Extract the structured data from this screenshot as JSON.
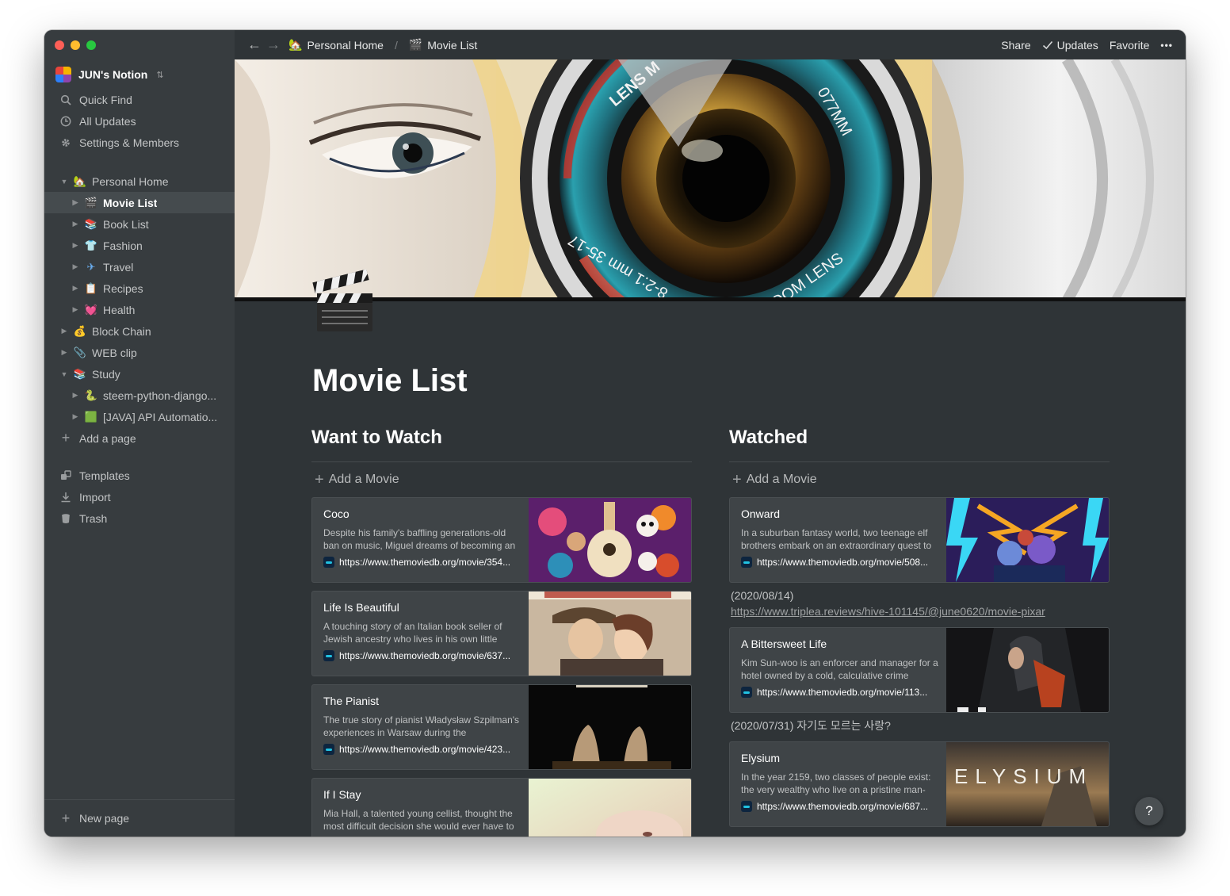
{
  "window": {
    "traffic_lights": {
      "close": "#fe5f57",
      "minimize": "#febc2e",
      "zoom": "#28c840"
    }
  },
  "sidebar": {
    "workspace_name": "JUN's Notion",
    "workspace_chevron": "⌃",
    "quick_items": [
      {
        "label": "Quick Find",
        "icon": "search-icon"
      },
      {
        "label": "All Updates",
        "icon": "clock-icon"
      },
      {
        "label": "Settings & Members",
        "icon": "gear-icon"
      }
    ],
    "tree": [
      {
        "label": "Personal Home",
        "emoji": "🏡",
        "level": 0,
        "expanded": true
      },
      {
        "label": "Movie List",
        "emoji": "🎬",
        "level": 1,
        "active": true
      },
      {
        "label": "Book List",
        "emoji": "📚",
        "level": 1
      },
      {
        "label": "Fashion",
        "emoji": "👕",
        "level": 1
      },
      {
        "label": "Travel",
        "emoji": "✈",
        "level": 1
      },
      {
        "label": "Recipes",
        "emoji": "📋",
        "level": 1
      },
      {
        "label": "Health",
        "emoji": "💓",
        "level": 1
      },
      {
        "label": "Block Chain",
        "emoji": "💰",
        "level": 0
      },
      {
        "label": "WEB clip",
        "emoji": "📎",
        "level": 0
      },
      {
        "label": "Study",
        "emoji": "📚",
        "level": 0,
        "expanded": true
      },
      {
        "label": "steem-python-django...",
        "emoji": "🐍",
        "level": 1
      },
      {
        "label": "[JAVA] API Automatio...",
        "emoji": "🟩",
        "level": 1
      }
    ],
    "add_page": "Add a page",
    "bottom_items": [
      {
        "label": "Templates",
        "icon": "templates-icon"
      },
      {
        "label": "Import",
        "icon": "import-icon"
      },
      {
        "label": "Trash",
        "icon": "trash-icon"
      }
    ],
    "new_page": "New page"
  },
  "topbar": {
    "back": "←",
    "forward": "→",
    "breadcrumb": [
      {
        "label": "Personal Home",
        "emoji": "🏡"
      },
      {
        "label": "Movie List",
        "emoji": "🎬"
      }
    ],
    "separator": "/",
    "share": "Share",
    "updates": "Updates",
    "favorite": "Favorite",
    "more": "•••"
  },
  "page": {
    "title": "Movie List",
    "icon": "clapperboard-icon"
  },
  "want_to_watch": {
    "heading": "Want to Watch",
    "add_label": "Add a Movie",
    "cards": [
      {
        "title": "Coco",
        "desc": "Despite his family's baffling generations-old ban on music, Miguel dreams of becoming an",
        "link": "https://www.themoviedb.org/movie/354...",
        "image": "coco-poster"
      },
      {
        "title": "Life Is Beautiful",
        "desc": "A touching story of an Italian book seller of Jewish ancestry who lives in his own little",
        "link": "https://www.themoviedb.org/movie/637...",
        "image": "life-is-beautiful-poster"
      },
      {
        "title": "The Pianist",
        "desc": "The true story of pianist Władysław Szpilman's experiences in Warsaw during the",
        "link": "https://www.themoviedb.org/movie/423...",
        "image": "the-pianist-poster"
      },
      {
        "title": "If I Stay",
        "desc": "Mia Hall, a talented young cellist, thought the most difficult decision she would ever have to",
        "link": "",
        "image": "if-i-stay-poster"
      }
    ]
  },
  "watched": {
    "heading": "Watched",
    "add_label": "Add a Movie",
    "items": [
      {
        "title": "Onward",
        "desc": "In a suburban fantasy world, two teenage elf brothers embark on an extraordinary quest to",
        "link": "https://www.themoviedb.org/movie/508...",
        "image": "onward-poster",
        "note": "(2020/08/14)",
        "note_link": "https://www.triplea.reviews/hive-101145/@june0620/movie-pixar"
      },
      {
        "title": "A Bittersweet Life",
        "desc": "Kim Sun-woo is an enforcer and manager for a hotel owned by a cold, calculative crime",
        "link": "https://www.themoviedb.org/movie/113...",
        "image": "bittersweet-life-poster",
        "note": "(2020/07/31) 자기도 모르는 사랑?",
        "note_link": ""
      },
      {
        "title": "Elysium",
        "desc": "In the year 2159, two classes of people exist: the very wealthy who live on a pristine man-",
        "link": "https://www.themoviedb.org/movie/687...",
        "image": "elysium-poster",
        "image_text": "ELYSIUM",
        "note": "",
        "note_link": ""
      }
    ]
  },
  "cover_text": {
    "top": "LENS M",
    "right": "077MM",
    "bottom": "8-2:1 mm 35-17",
    "zoom": "ZOOM LENS"
  },
  "help": "?"
}
